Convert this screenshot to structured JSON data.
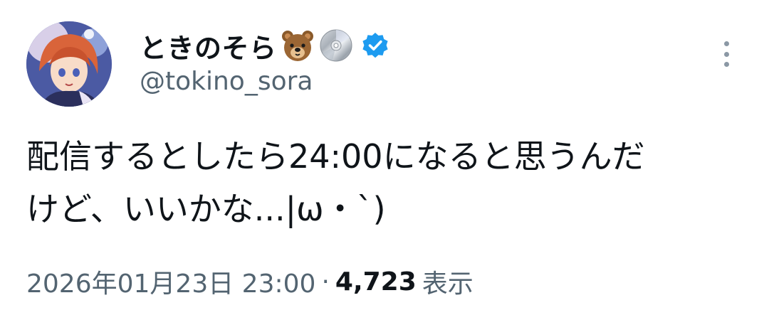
{
  "user": {
    "display_name": "ときのそら",
    "emoji_icons": [
      "bear-face-icon",
      "optical-disc-icon"
    ],
    "verified": true,
    "handle": "@tokino_sora"
  },
  "tweet": {
    "text_lines": [
      "配信するとしたら24:00になると思うんだ",
      "けど、いいかな...|ω・`)"
    ]
  },
  "meta": {
    "timestamp": "2026年01月23日 23:00",
    "separator": "·",
    "views_count": "4,723",
    "views_label": "表示"
  },
  "colors": {
    "text": "#0f1419",
    "secondary": "#536471",
    "verified_blue": "#1d9bf0"
  }
}
